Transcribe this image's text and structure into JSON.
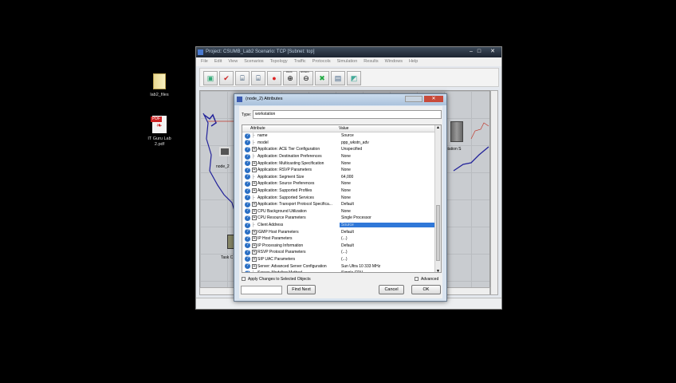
{
  "desktop": {
    "icons": [
      {
        "label": "lab2_files",
        "icon": "folder-icon"
      },
      {
        "label": "IT Guru Lab 2.pdf",
        "icon": "pdf-icon",
        "badge": "PDF"
      }
    ]
  },
  "window": {
    "title": "Project: CSUMB_Lab2 Scenario: TCP [Subnet: top]",
    "menu": [
      "File",
      "Edit",
      "View",
      "Scenarios",
      "Topology",
      "Traffic",
      "Protocols",
      "Simulation",
      "Results",
      "Windows",
      "Help"
    ],
    "toolbar": [
      "open-palette",
      "check-links",
      "fail-link",
      "recover-link",
      "return-to-parent",
      "zoom-in",
      "zoom-out",
      "configure-simulation",
      "view-results",
      "hide-graphs"
    ],
    "toolbar_labels": {
      "zoom_in": "zoom",
      "zoom_out": "unzoom"
    },
    "canvas_labels": [
      "node_2",
      "station S",
      "Task C"
    ]
  },
  "dialog": {
    "title": "(node_2) Attributes",
    "type_label": "Type:",
    "type_value": "workstation",
    "columns": [
      "Attribute",
      "Value"
    ],
    "rows": [
      {
        "a": "name",
        "v": "Source",
        "e": false
      },
      {
        "a": "model",
        "v": "ppp_wkstn_adv",
        "e": false
      },
      {
        "a": "Application: ACE Tier Configuration",
        "v": "Unspecified",
        "e": true
      },
      {
        "a": "Application: Destination Preferences",
        "v": "None",
        "e": false
      },
      {
        "a": "Application: Multicasting Specification",
        "v": "None",
        "e": true
      },
      {
        "a": "Application: RSVP Parameters",
        "v": "None",
        "e": true
      },
      {
        "a": "Application: Segment Size",
        "v": "64,000",
        "e": false
      },
      {
        "a": "Application: Source Preferences",
        "v": "None",
        "e": true
      },
      {
        "a": "Application: Supported Profiles",
        "v": "None",
        "e": true
      },
      {
        "a": "Application: Supported Services",
        "v": "None",
        "e": false
      },
      {
        "a": "Application: Transport Protocol Specifica...",
        "v": "Default",
        "e": true
      },
      {
        "a": "CPU Background Utilization",
        "v": "None",
        "e": true
      },
      {
        "a": "CPU Resource Parameters",
        "v": "Single Processor",
        "e": true
      },
      {
        "a": "Client Address",
        "v": "Source",
        "e": false,
        "selected": true
      },
      {
        "a": "IGMP Host Parameters",
        "v": "Default",
        "e": true
      },
      {
        "a": "IP Host Parameters",
        "v": "(...)",
        "e": true
      },
      {
        "a": "IP Processing Information",
        "v": "Default",
        "e": true
      },
      {
        "a": "RSVP Protocol Parameters",
        "v": "(...)",
        "e": true
      },
      {
        "a": "SIP UAC Parameters",
        "v": "(...)",
        "e": true
      },
      {
        "a": "Server: Advanced Server Configuration",
        "v": "Sun Ultra 10 333 MHz",
        "e": true
      },
      {
        "a": "Server: Modeling Method",
        "v": "Simple CPU",
        "e": false
      }
    ],
    "apply_label": "Apply Changes to Selected Objects",
    "advanced_label": "Advanced",
    "find_value": "",
    "find_next": "Find Next",
    "cancel": "Cancel",
    "ok": "OK"
  },
  "colors": {
    "selection": "#3078d8",
    "desktop": "#000000"
  }
}
